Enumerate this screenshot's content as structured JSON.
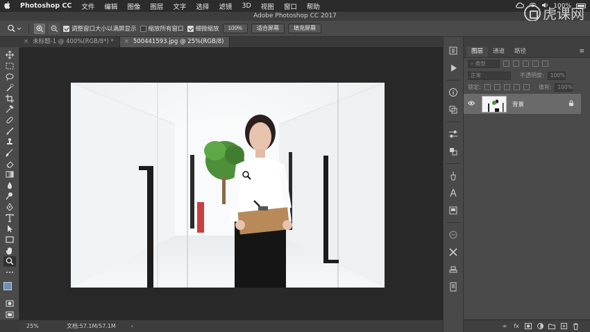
{
  "menubar": {
    "apple": "",
    "items": [
      "Photoshop CC",
      "文件",
      "编辑",
      "图像",
      "图层",
      "文字",
      "选择",
      "滤镜",
      "3D",
      "视图",
      "窗口",
      "帮助"
    ],
    "battery": "100%"
  },
  "window": {
    "title": "Adobe Photoshop CC 2017"
  },
  "watermark": {
    "text": "虎课网"
  },
  "options_bar": {
    "checkbox_resize": "调整窗口大小以满屏显示",
    "checkbox_zoom_all": "缩放所有窗口",
    "checkbox_scrubby": "细微缩放",
    "zoom_value": "100%",
    "fit_screen": "适合屏幕",
    "fill_screen": "填充屏幕"
  },
  "tabs": [
    {
      "label": "未标题-1 @ 400%(RGB/8*) *",
      "active": false
    },
    {
      "label": "500441593.jpg @ 25%(RGB/8)",
      "active": true
    }
  ],
  "status_bar": {
    "zoom": "25%",
    "doc": "文档:57.1M/57.1M",
    "arrow": "›"
  },
  "layers_panel": {
    "tabs": [
      "图层",
      "通道",
      "路径"
    ],
    "filter_kind": "类型",
    "blend_mode": "正常",
    "opacity_label": "不透明度:",
    "opacity_value": "100%",
    "lock_label": "锁定:",
    "fill_label": "填充:",
    "fill_value": "100%",
    "layers": [
      {
        "name": "背景",
        "visible": true,
        "locked": true
      }
    ]
  },
  "colors": {
    "foreground": "#6a8fb8",
    "background": "#ffffff",
    "accent": "#f4f5f6"
  }
}
